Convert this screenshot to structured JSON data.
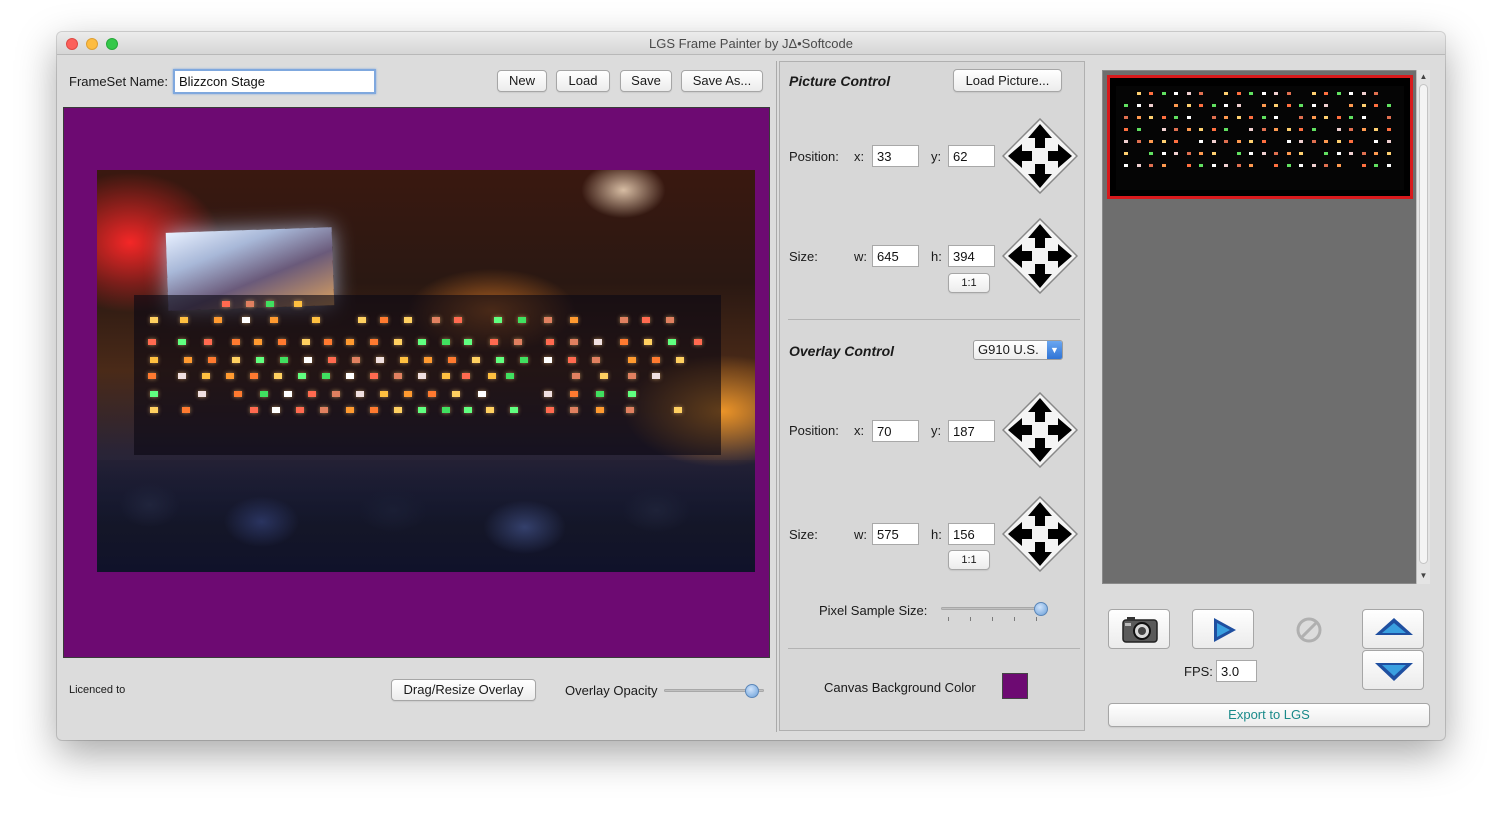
{
  "window": {
    "title": "LGS Frame Painter by JΔ•Softcode"
  },
  "frameset": {
    "name_label": "FrameSet Name:",
    "name_value": "Blizzcon Stage",
    "new_label": "New",
    "load_label": "Load",
    "save_label": "Save",
    "save_as_label": "Save As..."
  },
  "canvas": {
    "background_color": "#6d0a72"
  },
  "bottom_bar": {
    "licence_label": "Licenced to",
    "drag_resize_label": "Drag/Resize Overlay",
    "overlay_opacity_label": "Overlay Opacity",
    "overlay_opacity_value": 0.88
  },
  "picture_control": {
    "title": "Picture Control",
    "load_picture_label": "Load Picture...",
    "position_label": "Position:",
    "x_label": "x:",
    "x_value": "33",
    "y_label": "y:",
    "y_value": "62",
    "size_label": "Size:",
    "w_label": "w:",
    "w_value": "645",
    "h_label": "h:",
    "h_value": "394",
    "one_to_one_label": "1:1"
  },
  "overlay_control": {
    "title": "Overlay Control",
    "keyboard_model": "G910 U.S.",
    "position_label": "Position:",
    "x_label": "x:",
    "x_value": "70",
    "y_label": "y:",
    "y_value": "187",
    "size_label": "Size:",
    "w_label": "w:",
    "w_value": "575",
    "h_label": "h:",
    "h_value": "156",
    "one_to_one_label": "1:1",
    "pixel_sample_size_label": "Pixel Sample Size:",
    "pixel_sample_size_value": 1.0,
    "canvas_bg_color_label": "Canvas Background Color",
    "canvas_bg_color": "#6d0a72"
  },
  "playback": {
    "fps_label": "FPS:",
    "fps_value": "3.0",
    "export_label": "Export to LGS",
    "icons": [
      "camera-icon",
      "play-icon",
      "stop-icon",
      "move-up-icon",
      "move-down-icon"
    ]
  },
  "colors": {
    "accent_blue": "#2f74d6",
    "export_text": "#1a8a8a",
    "selected_frame_border": "#d8191c",
    "play_triangle": "#1f4fa0"
  }
}
